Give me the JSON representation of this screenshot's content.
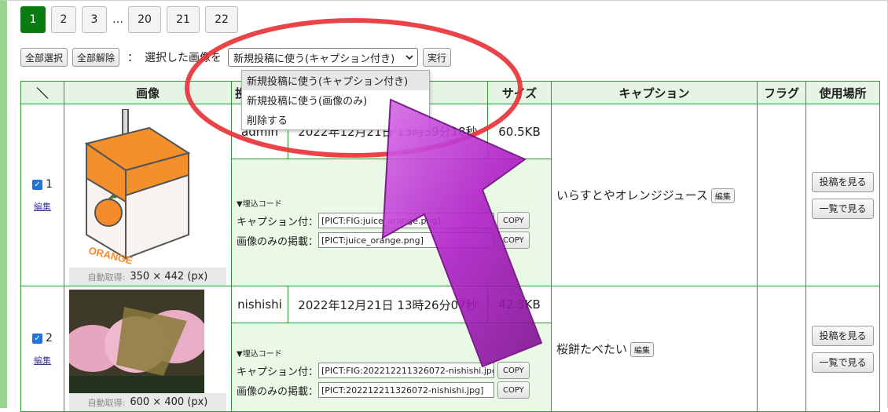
{
  "pagination": {
    "pages": [
      "1",
      "2",
      "3"
    ],
    "ellipsis": "…",
    "last_pages": [
      "20",
      "21",
      "22"
    ],
    "active": "1"
  },
  "bulk": {
    "select_all": "全部選択",
    "deselect_all": "全部解除",
    "colon": "：",
    "selected_label": "選択した画像を",
    "selected_option": "新規投稿に使う(キャプション付き)",
    "run": "実行",
    "options": [
      "新規投稿に使う(キャプション付き)",
      "新規投稿に使う(画像のみ)",
      "削除する"
    ]
  },
  "table": {
    "headers": {
      "check": "＼",
      "image": "画像",
      "poster": "投",
      "date": "",
      "size": "サイズ",
      "caption": "キャプション",
      "flag": "フラグ",
      "usage": "使用場所"
    },
    "rows": [
      {
        "num": "1",
        "edit": "編集",
        "auto_label": "自動取得:",
        "dims": "350 × 442 (px)",
        "poster": "admin",
        "date": "2022年12月21日 13時39分18秒",
        "size": "60.5KB",
        "embed_title": "▼埋込コード",
        "caption_label": "キャプション付：",
        "caption_code": "[PICT:FIG:juice_orange.png]",
        "image_label": "画像のみの掲載：",
        "image_code": "[PICT:juice_orange.png]",
        "copy": "COPY",
        "caption": "いらすとやオレンジジュース",
        "caption_edit": "編集",
        "view_post": "投稿を見る",
        "view_list": "一覧で見る",
        "carton_text": "ORANGE"
      },
      {
        "num": "2",
        "edit": "編集",
        "auto_label": "自動取得:",
        "dims": "600 × 400 (px)",
        "poster": "nishishi",
        "date": "2022年12月21日 13時26分07秒",
        "size": "42.3KB",
        "embed_title": "▼埋込コード",
        "caption_label": "キャプション付：",
        "caption_code": "[PICT:FIG:202212211326072-nishishi.jpg]",
        "image_label": "画像のみの掲載：",
        "image_code": "[PICT:202212211326072-nishishi.jpg]",
        "copy": "COPY",
        "caption": "桜餅たべたい",
        "caption_edit": "編集",
        "view_post": "投稿を見る",
        "view_list": "一覧で見る"
      }
    ]
  },
  "colors": {
    "accent_green": "#0a7a11",
    "table_border": "#2e9a34",
    "header_bg": "#e6f5e3",
    "highlight_circle": "#e8343a",
    "arrow_purple": "#b01fc8"
  }
}
